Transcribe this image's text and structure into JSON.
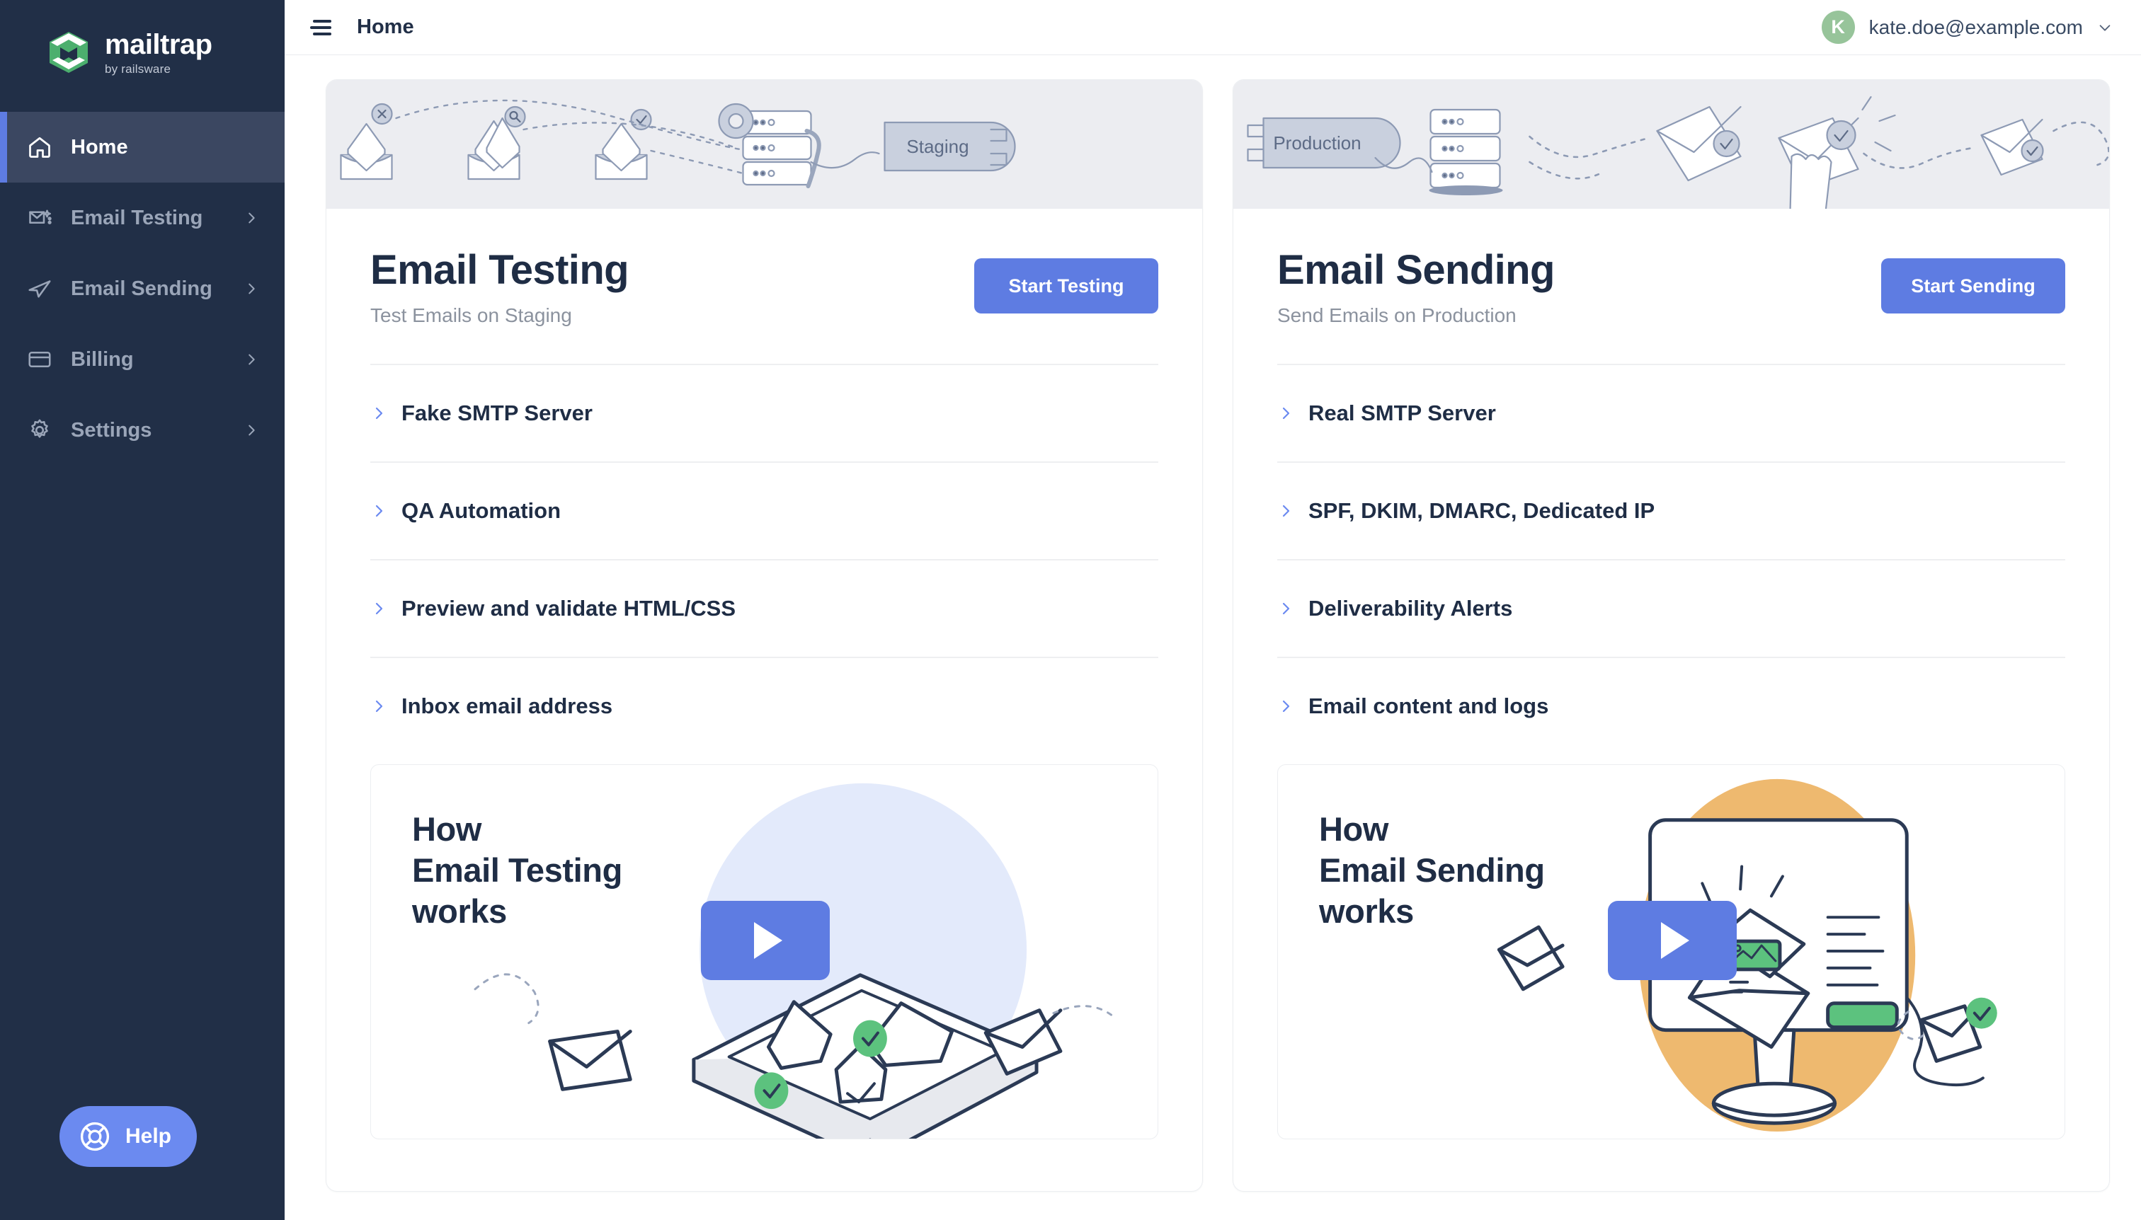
{
  "brand": {
    "name": "mailtrap",
    "tagline": "by railsware",
    "logo_colors": {
      "green": "#4caf6e",
      "white": "#ffffff",
      "navy": "#212f47"
    }
  },
  "colors": {
    "sidebar_bg": "#212f47",
    "sidebar_active_bg": "#3b4761",
    "accent_blue": "#5e7ce2",
    "help_blue": "#6b8af0",
    "avatar_green": "#97c49a",
    "banner_gray": "#ecedf1",
    "heading_navy": "#1f2d45",
    "muted_text": "#8b929e"
  },
  "sidebar": {
    "items": [
      {
        "label": "Home",
        "icon": "home-icon",
        "active": true,
        "has_chevron": false
      },
      {
        "label": "Email Testing",
        "icon": "envelope-sparkle-icon",
        "active": false,
        "has_chevron": true
      },
      {
        "label": "Email Sending",
        "icon": "paper-plane-icon",
        "active": false,
        "has_chevron": true
      },
      {
        "label": "Billing",
        "icon": "credit-card-icon",
        "active": false,
        "has_chevron": true
      },
      {
        "label": "Settings",
        "icon": "gear-icon",
        "active": false,
        "has_chevron": true
      }
    ],
    "help": {
      "label": "Help",
      "icon": "lifebuoy-icon"
    }
  },
  "topbar": {
    "menu_icon": "hamburger-menu-icon",
    "title": "Home",
    "user": {
      "avatar_initial": "K",
      "email": "kate.doe@example.com",
      "chevron_icon": "chevron-down-icon"
    }
  },
  "cards": [
    {
      "id": "email-testing",
      "banner_label": "Staging",
      "banner_illustration": "envelopes-to-server-staging-illustration",
      "title": "Email Testing",
      "subtitle": "Test Emails on Staging",
      "cta_label": "Start Testing",
      "accordion": [
        {
          "label": "Fake SMTP Server",
          "icon": "chevron-right-icon"
        },
        {
          "label": "QA Automation",
          "icon": "chevron-right-icon"
        },
        {
          "label": "Preview and validate HTML/CSS",
          "icon": "chevron-right-icon"
        },
        {
          "label": "Inbox email address",
          "icon": "chevron-right-icon"
        }
      ],
      "video": {
        "title": "How\nEmail Testing\nworks",
        "play_icon": "play-button-icon",
        "illustration": "sandbox-tray-with-envelopes-illustration",
        "blob_color": "#e3eafb"
      }
    },
    {
      "id": "email-sending",
      "banner_label": "Production",
      "banner_illustration": "server-production-to-envelopes-illustration",
      "title": "Email Sending",
      "subtitle": "Send Emails on Production",
      "cta_label": "Start Sending",
      "accordion": [
        {
          "label": "Real SMTP Server",
          "icon": "chevron-right-icon"
        },
        {
          "label": "SPF, DKIM, DMARC, Dedicated IP",
          "icon": "chevron-right-icon"
        },
        {
          "label": "Deliverability Alerts",
          "icon": "chevron-right-icon"
        },
        {
          "label": "Email content and logs",
          "icon": "chevron-right-icon"
        }
      ],
      "video": {
        "title": "How\nEmail Sending\nworks",
        "play_icon": "play-button-icon",
        "illustration": "monitor-with-email-illustration",
        "blob_color": "#eeb96f"
      }
    }
  ]
}
